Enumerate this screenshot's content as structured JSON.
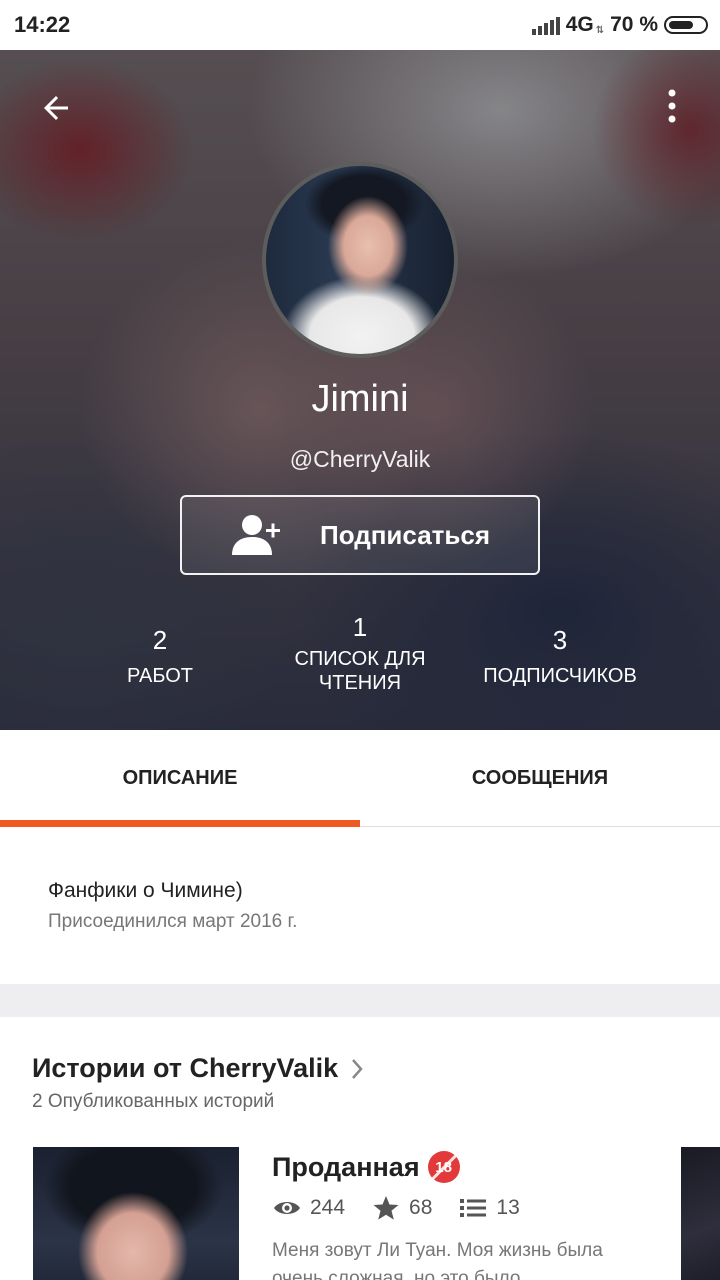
{
  "status_bar": {
    "time": "14:22",
    "network": "4G",
    "battery": "70 %",
    "battery_level": 0.7
  },
  "profile": {
    "name": "Jimini",
    "handle": "@CherryValik",
    "subscribe_label": "Подписаться"
  },
  "stats": [
    {
      "value": "2",
      "label": "РАБОТ"
    },
    {
      "value": "1",
      "label": "СПИСОК ДЛЯ ЧТЕНИЯ"
    },
    {
      "value": "3",
      "label": "ПОДПИСЧИКОВ"
    }
  ],
  "tabs": [
    {
      "label": "ОПИСАНИЕ",
      "active": true
    },
    {
      "label": "СООБЩЕНИЯ",
      "active": false
    }
  ],
  "about": {
    "description": "Фанфики о Чимине)",
    "joined": "Присоединился март 2016 г."
  },
  "stories": {
    "title": "Истории от CherryValik",
    "count": "2 Опубликованных историй",
    "items": [
      {
        "title": "Проданная",
        "age_badge": "18",
        "views": "244",
        "votes": "68",
        "parts": "13",
        "description": "Меня зовут Ли Туан. Моя жизнь была очень сложная, но это было"
      }
    ]
  },
  "colors": {
    "accent": "#f05a22",
    "badge": "#e23a3a"
  },
  "icons": [
    "back-arrow-icon",
    "more-vert-icon",
    "add-person-icon",
    "chevron-right-icon",
    "eye-icon",
    "star-icon",
    "list-icon"
  ]
}
